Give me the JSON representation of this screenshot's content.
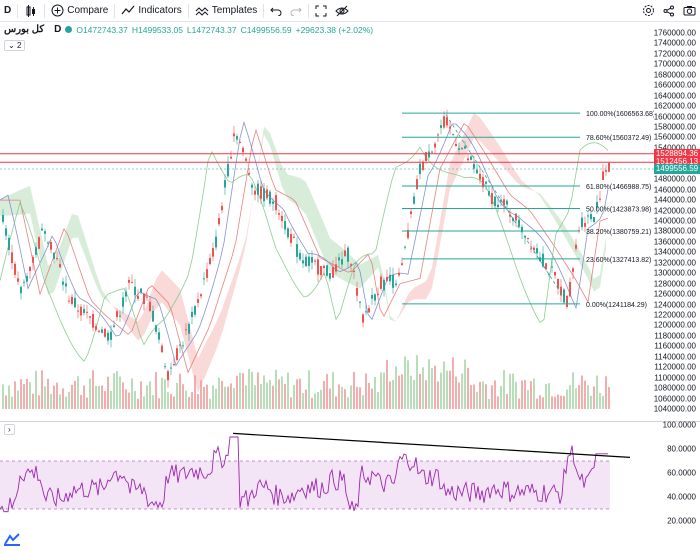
{
  "toolbar": {
    "interval": "D",
    "compare_label": "Compare",
    "indicators_label": "Indicators",
    "templates_label": "Templates"
  },
  "legend": {
    "symbol": "کل بورس",
    "interval": "D",
    "open": "O1472743.37",
    "high": "H1499533.05",
    "low": "L1472743.37",
    "close": "C1499556.59",
    "change": "+29623.38 (+2.02%)"
  },
  "badges": {
    "collapsed_count": "2",
    "rsi_toggle": "›"
  },
  "price_axis": {
    "ticks": [
      "1760000.00",
      "1740000.00",
      "1720000.00",
      "1700000.00",
      "1680000.00",
      "1660000.00",
      "1640000.00",
      "1620000.00",
      "1600000.00",
      "1580000.00",
      "1560000.00",
      "1540000.00",
      "1520000.00",
      "1500000.00",
      "1480000.00",
      "1460000.00",
      "1440000.00",
      "1420000.00",
      "1400000.00",
      "1380000.00",
      "1360000.00",
      "1340000.00",
      "1320000.00",
      "1300000.00",
      "1280000.00",
      "1260000.00",
      "1240000.00",
      "1220000.00",
      "1200000.00",
      "1180000.00",
      "1160000.00",
      "1140000.00",
      "1120000.00",
      "1100000.00",
      "1080000.00",
      "1060000.00",
      "1040000.00"
    ],
    "tags": [
      {
        "value": "1528894.36",
        "color": "#f23645"
      },
      {
        "value": "1512456.13",
        "color": "#f23645"
      },
      {
        "value": "1499556.59",
        "color": "#26a69a"
      }
    ]
  },
  "rsi_axis": {
    "ticks": [
      "100.0000",
      "80.0000",
      "60.0000",
      "40.0000",
      "20.0000"
    ]
  },
  "fib": [
    {
      "label": "100.00%(1606563.68)",
      "price": 1606563.68
    },
    {
      "label": "78.60%(1560372.49)",
      "price": 1560372.49
    },
    {
      "label": "61.80%(1466988.75)",
      "price": 1466988.75
    },
    {
      "label": "50.00%(1423873.98)",
      "price": 1423873.98
    },
    {
      "label": "38.20%(1380759.21)",
      "price": 1380759.21
    },
    {
      "label": "23.60%(1327413.82)",
      "price": 1327413.82
    },
    {
      "label": "0.00%(1241184.29)",
      "price": 1241184.29
    }
  ],
  "hlines": [
    1528894.36,
    1512456.13
  ],
  "last_price": 1499556.59,
  "colors": {
    "up": "#26a69a",
    "down": "#ef5350",
    "fib": "#26a69a",
    "rsi": "#9c27b0",
    "rsi_band": "#f3e5f5",
    "kumo_bear": "#f8c9c9",
    "kumo_bull": "#c8e6c9"
  },
  "rsi_levels": [
    70,
    30
  ],
  "rsi_trendline": {
    "from_value": 93,
    "to_value": 73
  }
}
